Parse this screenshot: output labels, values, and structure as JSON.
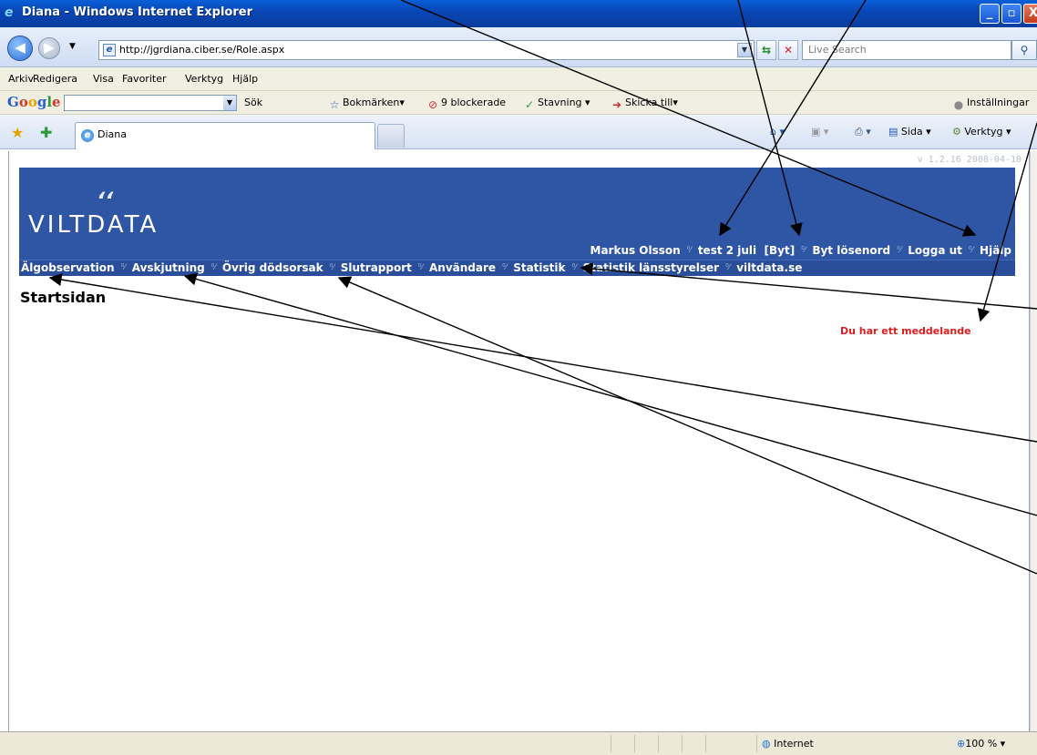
{
  "window": {
    "title": "Diana - Windows Internet Explorer",
    "min": "_",
    "max": "▫",
    "close": "X"
  },
  "address": {
    "url": "http://jgrdiana.ciber.se/Role.aspx",
    "search_placeholder": "Live Search"
  },
  "menu": {
    "items": [
      "Arkiv",
      "Redigera",
      "Visa",
      "Favoriter",
      "Verktyg",
      "Hjälp"
    ]
  },
  "google_toolbar": {
    "logo": "Google",
    "search_label": "Sök",
    "bookmarks": "Bokmärken",
    "blocked": "9 blockerade",
    "spelling": "Stavning",
    "send_to": "Skicka till",
    "settings": "Inställningar"
  },
  "tabs": {
    "active_tab": "Diana",
    "tools": {
      "page": "Sida",
      "tools": "Verktyg"
    }
  },
  "page": {
    "version": "v 1.2.16 2008-04-10",
    "logo_text": "VILTDATA",
    "user_bar": {
      "user": "Markus Olsson",
      "role": "test 2 juli",
      "switch": "[Byt]",
      "change_password": "Byt lösenord",
      "logout": "Logga ut",
      "help": "Hjälp"
    },
    "nav": [
      "Älgobservation",
      "Avskjutning",
      "Övrig dödsorsak",
      "Slutrapport",
      "Användare",
      "Statistik",
      "Statistik länsstyrelser",
      "viltdata.se"
    ],
    "title": "Startsidan",
    "message": "Du har ett meddelande"
  },
  "status": {
    "zone": "Internet",
    "zoom": "100 %"
  },
  "colors": {
    "banner": "#2f56a4",
    "message": "#e01b1b"
  }
}
